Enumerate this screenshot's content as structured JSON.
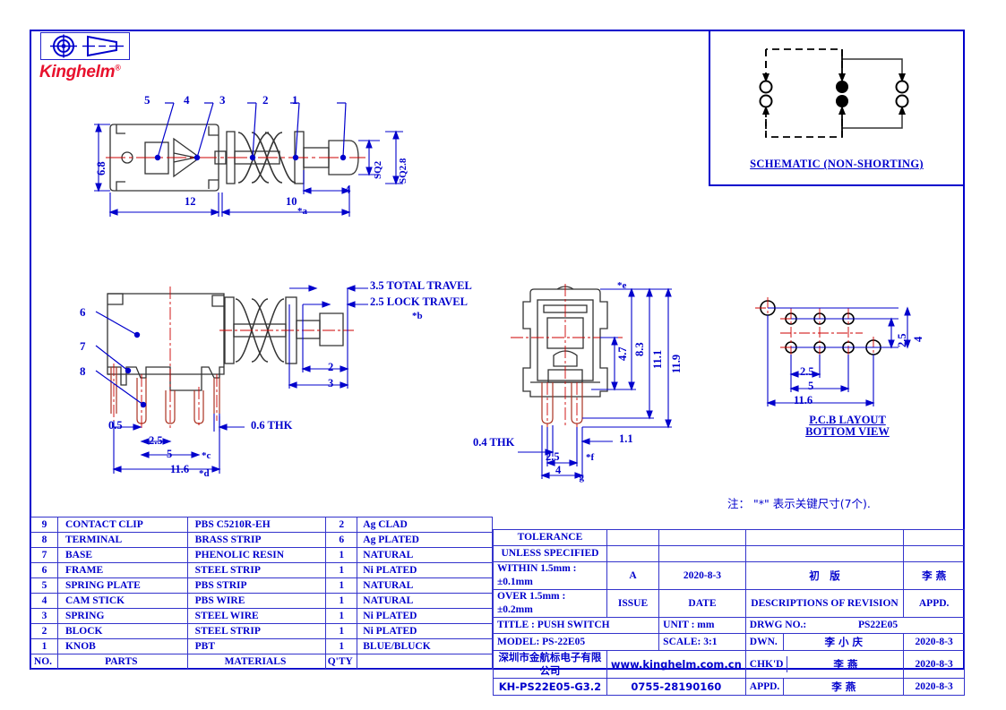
{
  "brand": {
    "name": "Kinghelm",
    "registered": "®"
  },
  "schematic": {
    "caption": "SCHEMATIC  (NON-SHORTING)"
  },
  "top_view": {
    "callouts": [
      "5",
      "4",
      "3",
      "2",
      "1"
    ],
    "dims": {
      "height": "6.8",
      "body_length": "12",
      "plunger_length": "10",
      "star_a": "*a",
      "tip_length": "4",
      "sq_small": "SQ2",
      "sq_large": "SQ2.8"
    }
  },
  "side_view": {
    "callouts": [
      "6",
      "7",
      "8"
    ],
    "dims": {
      "total_travel": "3.5  TOTAL  TRAVEL",
      "lock_travel": "2.5  LOCK  TRAVEL",
      "star_b": "*b",
      "d2": "2",
      "d3": "3",
      "pin_offset": "0.5",
      "pitch_2_5": "2.5",
      "span_5": "5",
      "star_c": "*c",
      "width_11_6": "11.6",
      "star_d": "*d",
      "thickness": "0.6  THK"
    }
  },
  "front_view": {
    "dims": {
      "star_e": "*e",
      "h_4_7": "4.7",
      "h_8_3": "8.3",
      "h_11_1": "11.1",
      "h_11_9": "11.9",
      "w_1_1": "1.1",
      "thickness": "0.4  THK",
      "pitch_2_5": "2.5",
      "star_f": "*f",
      "w_4": "4",
      "star_g": "*g"
    }
  },
  "pcb_layout": {
    "caption_line1": "P.C.B  LAYOUT",
    "caption_line2": "BOTTOM  VIEW",
    "dims": {
      "pitch": "2.5",
      "span": "5",
      "width": "11.6",
      "v_2_5": "2.5",
      "v_4": "4"
    }
  },
  "note": "注： \"*\"  表示关键尺寸(7个).",
  "parts_table": {
    "columns": [
      "NO.",
      "PARTS",
      "MATERIALS",
      "Q'TY",
      ""
    ],
    "rows": [
      {
        "no": "9",
        "part": "CONTACT  CLIP",
        "material": "PBS  C5210R-EH",
        "qty": "2",
        "finish": "Ag  CLAD"
      },
      {
        "no": "8",
        "part": "TERMINAL",
        "material": "BRASS  STRIP",
        "qty": "6",
        "finish": "Ag  PLATED"
      },
      {
        "no": "7",
        "part": "BASE",
        "material": "PHENOLIC  RESIN",
        "qty": "1",
        "finish": "NATURAL"
      },
      {
        "no": "6",
        "part": "FRAME",
        "material": "STEEL  STRIP",
        "qty": "1",
        "finish": "Ni  PLATED"
      },
      {
        "no": "5",
        "part": "SPRING  PLATE",
        "material": "PBS  STRIP",
        "qty": "1",
        "finish": "NATURAL"
      },
      {
        "no": "4",
        "part": "CAM  STICK",
        "material": "PBS  WIRE",
        "qty": "1",
        "finish": "NATURAL"
      },
      {
        "no": "3",
        "part": "SPRING",
        "material": "STEEL  WIRE",
        "qty": "1",
        "finish": "Ni  PLATED"
      },
      {
        "no": "2",
        "part": "BLOCK",
        "material": "STEEL  STRIP",
        "qty": "1",
        "finish": "Ni  PLATED"
      },
      {
        "no": "1",
        "part": "KNOB",
        "material": "PBT",
        "qty": "1",
        "finish": "BLUE/BLUCK"
      }
    ]
  },
  "title_block": {
    "tolerance_label_l1": "TOLERANCE",
    "tolerance_label_l2": "UNLESS   SPECIFIED",
    "tol_within": "WITHIN  1.5mm  :  ±0.1mm",
    "tol_over": "OVER  1.5mm  :  ±0.2mm",
    "issue_value": "A",
    "issue_label": "ISSUE",
    "date_value": "2020-8-3",
    "date_label": "DATE",
    "revision_value": "初　版",
    "revision_label": "DESCRIPTIONS  OF  REVISION",
    "appd_value": "李 燕",
    "appd_label": "APPD.",
    "title": "TITLE :   PUSH  SWITCH",
    "model": "MODEL:   PS-22E05",
    "company_cn": "深圳市金航标电子有限公司",
    "part_code": "KH-PS22E05-G3.2",
    "website": "www.kinghelm.com.cn",
    "phone": "0755-28190160",
    "unit_label": "UNIT :    mm",
    "scale_label": "SCALE:   3:1",
    "drwg_label": "DRWG  NO.:",
    "drwg_value": "PS22E05",
    "dwn_label": "DWN.",
    "dwn_name": "李 小 庆",
    "dwn_date": "2020-8-3",
    "chkd_label": "CHK'D",
    "chkd_name": "李 燕",
    "chkd_date": "2020-8-3",
    "appd2_label": "APPD.",
    "appd2_name": "李 燕",
    "appd2_date": "2020-8-3"
  }
}
